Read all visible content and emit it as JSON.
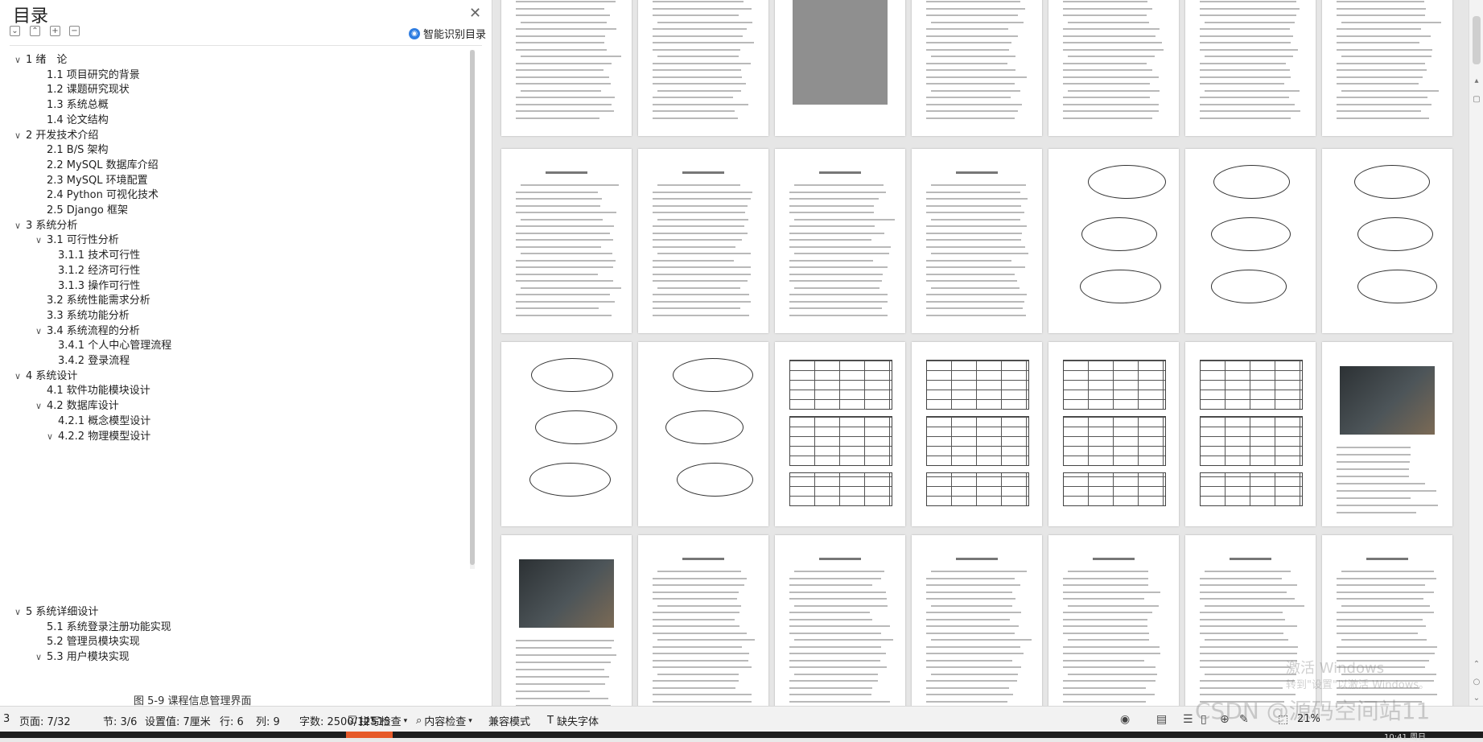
{
  "toc": {
    "title": "目录",
    "smart_button": "智能识别目录",
    "items": [
      {
        "label": "1  绪　论",
        "level": 1,
        "expanded": true
      },
      {
        "label": "1.1 项目研究的背景",
        "level": 2
      },
      {
        "label": "1.2 课题研究现状",
        "level": 2
      },
      {
        "label": "1.3 系统总概",
        "level": 2
      },
      {
        "label": "1.4 论文结构",
        "level": 2
      },
      {
        "label": "2  开发技术介绍",
        "level": 1,
        "expanded": true
      },
      {
        "label": "2.1 B/S 架构",
        "level": 2
      },
      {
        "label": "2.2 MySQL 数据库介绍",
        "level": 2
      },
      {
        "label": "2.3 MySQL 环境配置",
        "level": 2
      },
      {
        "label": "2.4 Python 可视化技术",
        "level": 2
      },
      {
        "label": "2.5 Django 框架",
        "level": 2
      },
      {
        "label": "3  系统分析",
        "level": 1,
        "expanded": true
      },
      {
        "label": "3.1 可行性分析",
        "level": 2,
        "expanded": true
      },
      {
        "label": "3.1.1 技术可行性",
        "level": 3
      },
      {
        "label": "3.1.2 经济可行性",
        "level": 3
      },
      {
        "label": "3.1.3 操作可行性",
        "level": 3
      },
      {
        "label": "3.2 系统性能需求分析",
        "level": 2
      },
      {
        "label": "3.3 系统功能分析",
        "level": 2
      },
      {
        "label": "3.4 系统流程的分析",
        "level": 2,
        "expanded": true
      },
      {
        "label": "3.4.1 个人中心管理流程",
        "level": 3
      },
      {
        "label": "3.4.2 登录流程",
        "level": 3
      },
      {
        "label": "4 系统设计",
        "level": 1,
        "expanded": true
      },
      {
        "label": "4.1 软件功能模块设计",
        "level": 2
      },
      {
        "label": "4.2 数据库设计",
        "level": 2,
        "expanded": true
      },
      {
        "label": "4.2.1 概念模型设计",
        "level": 3
      },
      {
        "label": "4.2.2 物理模型设计",
        "level": 3,
        "expanded": true
      }
    ],
    "items_lower": [
      {
        "label": "5 系统详细设计",
        "level": 1,
        "expanded": true
      },
      {
        "label": "5.1 系统登录注册功能实现",
        "level": 2
      },
      {
        "label": "5.2 管理员模块实现",
        "level": 2
      },
      {
        "label": "5.3 用户模块实现",
        "level": 2,
        "expanded": true
      }
    ],
    "bottom_caption": "图 5-9 课程信息管理界面"
  },
  "status": {
    "left_num": "3",
    "page": "页面: 7/32",
    "section": "节: 3/6",
    "setting": "设置值: 7厘米",
    "row": "行: 6",
    "col": "列: 9",
    "wordcount": "字数: 2500/12515",
    "spellcheck": "拼写检查",
    "content_check": "内容检查",
    "compat_mode": "兼容模式",
    "missing_font": "缺失字体",
    "zoom": "21%"
  },
  "watermark": "CSDN @源码空间站11",
  "windows_activate": {
    "line1": "激活 Windows",
    "line2": "转到\"设置\"以激活 Windows。"
  },
  "taskbar": {
    "clock": "10:41 周日"
  },
  "icons": {
    "close": "close-icon",
    "collapse_all": "collapse-icon",
    "expand_all": "expand-icon",
    "add": "add-icon",
    "remove": "remove-icon",
    "smart": "ai-icon"
  }
}
